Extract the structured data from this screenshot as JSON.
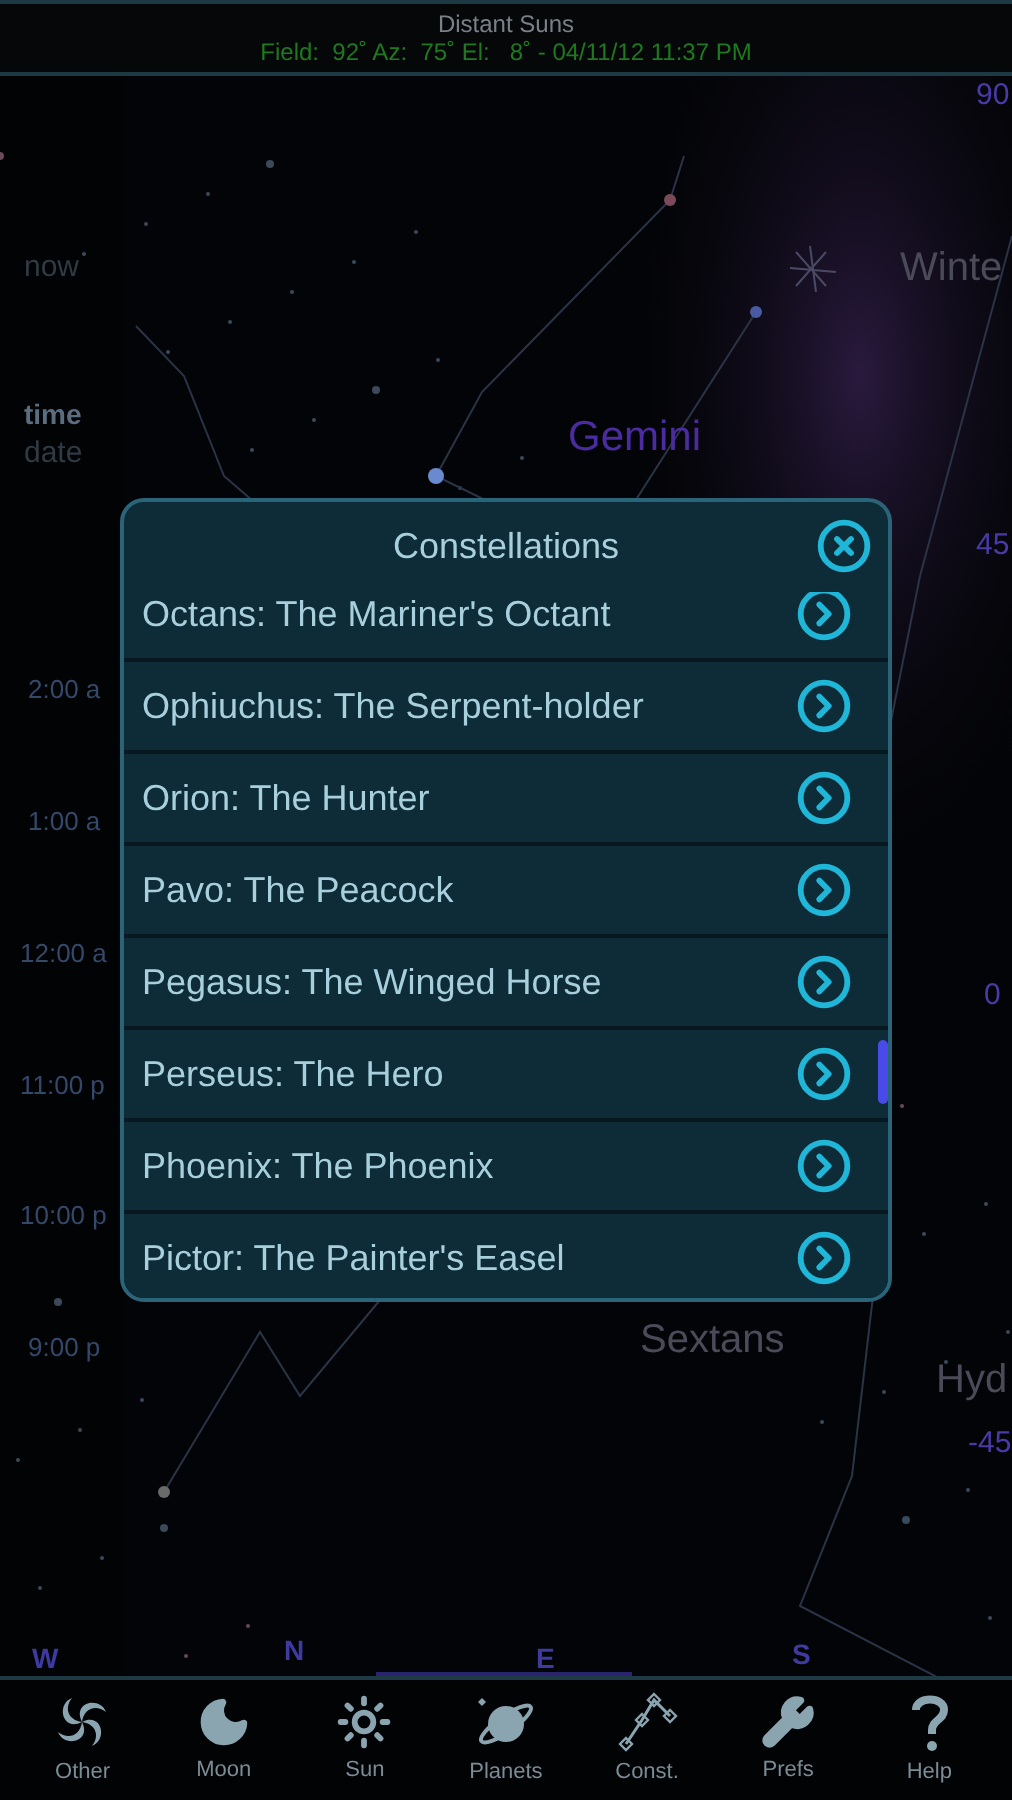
{
  "header": {
    "title": "Distant Suns",
    "status": "Field:  92˚ Az:  75˚ El:   8˚ - 04/11/12 11:37 PM"
  },
  "time_panel": [
    {
      "text": "now",
      "kind": "dim"
    },
    {
      "text": "time",
      "kind": "bright"
    },
    {
      "text": "date",
      "kind": "dim"
    },
    {
      "text": "2:00 a",
      "kind": "hour"
    },
    {
      "text": "1:00 a",
      "kind": "hour"
    },
    {
      "text": "12:00 a",
      "kind": "hour"
    },
    {
      "text": "11:00 p",
      "kind": "hour"
    },
    {
      "text": "10:00 p",
      "kind": "hour"
    },
    {
      "text": "9:00 p",
      "kind": "hour"
    }
  ],
  "sky_labels": [
    {
      "text": "90",
      "kind": "scale"
    },
    {
      "text": "Winte",
      "kind": "constellation"
    },
    {
      "text": "Gemini",
      "kind": "highlight"
    },
    {
      "text": "45",
      "kind": "scale"
    },
    {
      "text": "0",
      "kind": "scale"
    },
    {
      "text": "Sextans",
      "kind": "constellation"
    },
    {
      "text": "Hyd",
      "kind": "constellation"
    },
    {
      "text": "-45",
      "kind": "scale"
    },
    {
      "text": "W",
      "kind": "compass"
    },
    {
      "text": "N",
      "kind": "compass"
    },
    {
      "text": "E",
      "kind": "compass"
    },
    {
      "text": "S",
      "kind": "compass"
    }
  ],
  "dialog": {
    "title": "Constellations",
    "items": [
      {
        "label": "Octans: The Mariner's Octant"
      },
      {
        "label": "Ophiuchus: The Serpent-holder"
      },
      {
        "label": "Orion: The Hunter"
      },
      {
        "label": "Pavo: The Peacock"
      },
      {
        "label": "Pegasus: The Winged Horse"
      },
      {
        "label": "Perseus: The Hero"
      },
      {
        "label": "Phoenix: The Phoenix"
      },
      {
        "label": "Pictor: The Painter's Easel"
      }
    ]
  },
  "toolbar": [
    {
      "label": "Other",
      "kind": "galaxy"
    },
    {
      "label": "Moon",
      "kind": "moon"
    },
    {
      "label": "Sun",
      "kind": "sun"
    },
    {
      "label": "Planets",
      "kind": "planet"
    },
    {
      "label": "Const.",
      "kind": "constellation"
    },
    {
      "label": "Prefs",
      "kind": "wrench"
    },
    {
      "label": "Help",
      "kind": "help"
    }
  ]
}
